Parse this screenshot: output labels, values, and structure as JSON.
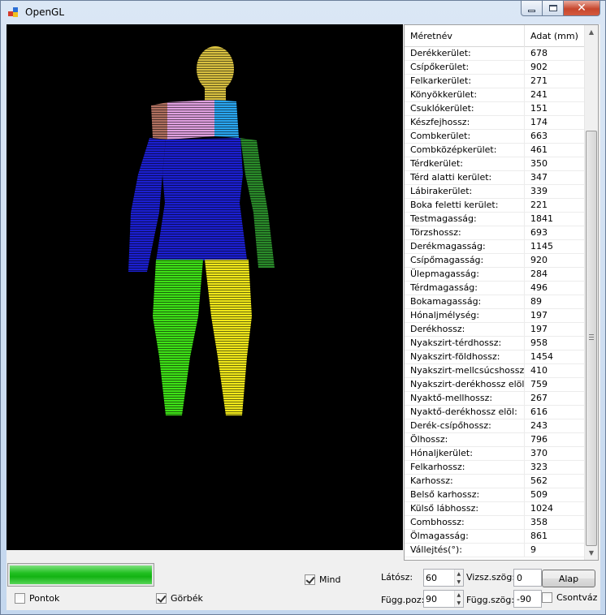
{
  "window": {
    "title": "OpenGL"
  },
  "grid": {
    "headers": [
      "Méretnév",
      "Adat (mm)"
    ],
    "rows": [
      [
        "Derékkerület:",
        "678"
      ],
      [
        "Csípőkerület:",
        "902"
      ],
      [
        "Felkarkerület:",
        "271"
      ],
      [
        "Könyökkerület:",
        "241"
      ],
      [
        "Csuklókerület:",
        "151"
      ],
      [
        "Készfejhossz:",
        "174"
      ],
      [
        "Combkerület:",
        "663"
      ],
      [
        "Combközépkerület:",
        "461"
      ],
      [
        "Térdkerület:",
        "350"
      ],
      [
        "Térd alatti kerület:",
        "347"
      ],
      [
        "Lábirakerület:",
        "339"
      ],
      [
        "Boka feletti kerület:",
        "221"
      ],
      [
        "Testmagasság:",
        "1841"
      ],
      [
        "Törzshossz:",
        "693"
      ],
      [
        "Derékmagasság:",
        "1145"
      ],
      [
        "Csípőmagasság:",
        "920"
      ],
      [
        "Ülepmagasság:",
        "284"
      ],
      [
        "Térdmagasság:",
        "496"
      ],
      [
        "Bokamagasság:",
        "89"
      ],
      [
        "Hónaljmélység:",
        "197"
      ],
      [
        "Derékhossz:",
        "197"
      ],
      [
        "Nyakszirt-térdhossz:",
        "958"
      ],
      [
        "Nyakszirt-földhossz:",
        "1454"
      ],
      [
        "Nyakszirt-mellcsúcshossz:",
        "410"
      ],
      [
        "Nyakszirt-derékhossz elöl:",
        "759"
      ],
      [
        "Nyaktő-mellhossz:",
        "267"
      ],
      [
        "Nyaktő-derékhossz elöl:",
        "616"
      ],
      [
        "Derék-csípőhossz:",
        "243"
      ],
      [
        "Ölhossz:",
        "796"
      ],
      [
        "Hónaljkerület:",
        "370"
      ],
      [
        "Felkarhossz:",
        "323"
      ],
      [
        "Karhossz:",
        "562"
      ],
      [
        "Belső karhossz:",
        "509"
      ],
      [
        "Külső lábhossz:",
        "1024"
      ],
      [
        "Combhossz:",
        "358"
      ],
      [
        "Ölmagasság:",
        "861"
      ],
      [
        "Vállejtés(°):",
        "9"
      ]
    ]
  },
  "progress": {
    "value_percent": 100
  },
  "controls": {
    "mind_label": "Mind",
    "mind_checked": true,
    "pontok_label": "Pontok",
    "pontok_checked": false,
    "gorbek_label": "Görbék",
    "gorbek_checked": true,
    "latosz_label": "Látósz:",
    "latosz_value": "60",
    "vizsz_label": "Vizsz.szög:",
    "vizsz_value": "0",
    "alap_label": "Alap",
    "fugg_poz_label": "Függ.poz:",
    "fugg_poz_value": "90",
    "fugg_szog_label": "Függ.szög:",
    "fugg_szog_value": "-90",
    "csontvaz_label": "Csontváz",
    "csontvaz_checked": false
  },
  "colors": {
    "torso": "#1b1fd0",
    "left_leg": "#3ee017",
    "right_leg": "#f0e81a",
    "head": "#d8c040",
    "left_arm": "#2a8a2a",
    "shoulder_pink": "#e0a0e0",
    "shoulder_cyan": "#2aa6f0"
  }
}
